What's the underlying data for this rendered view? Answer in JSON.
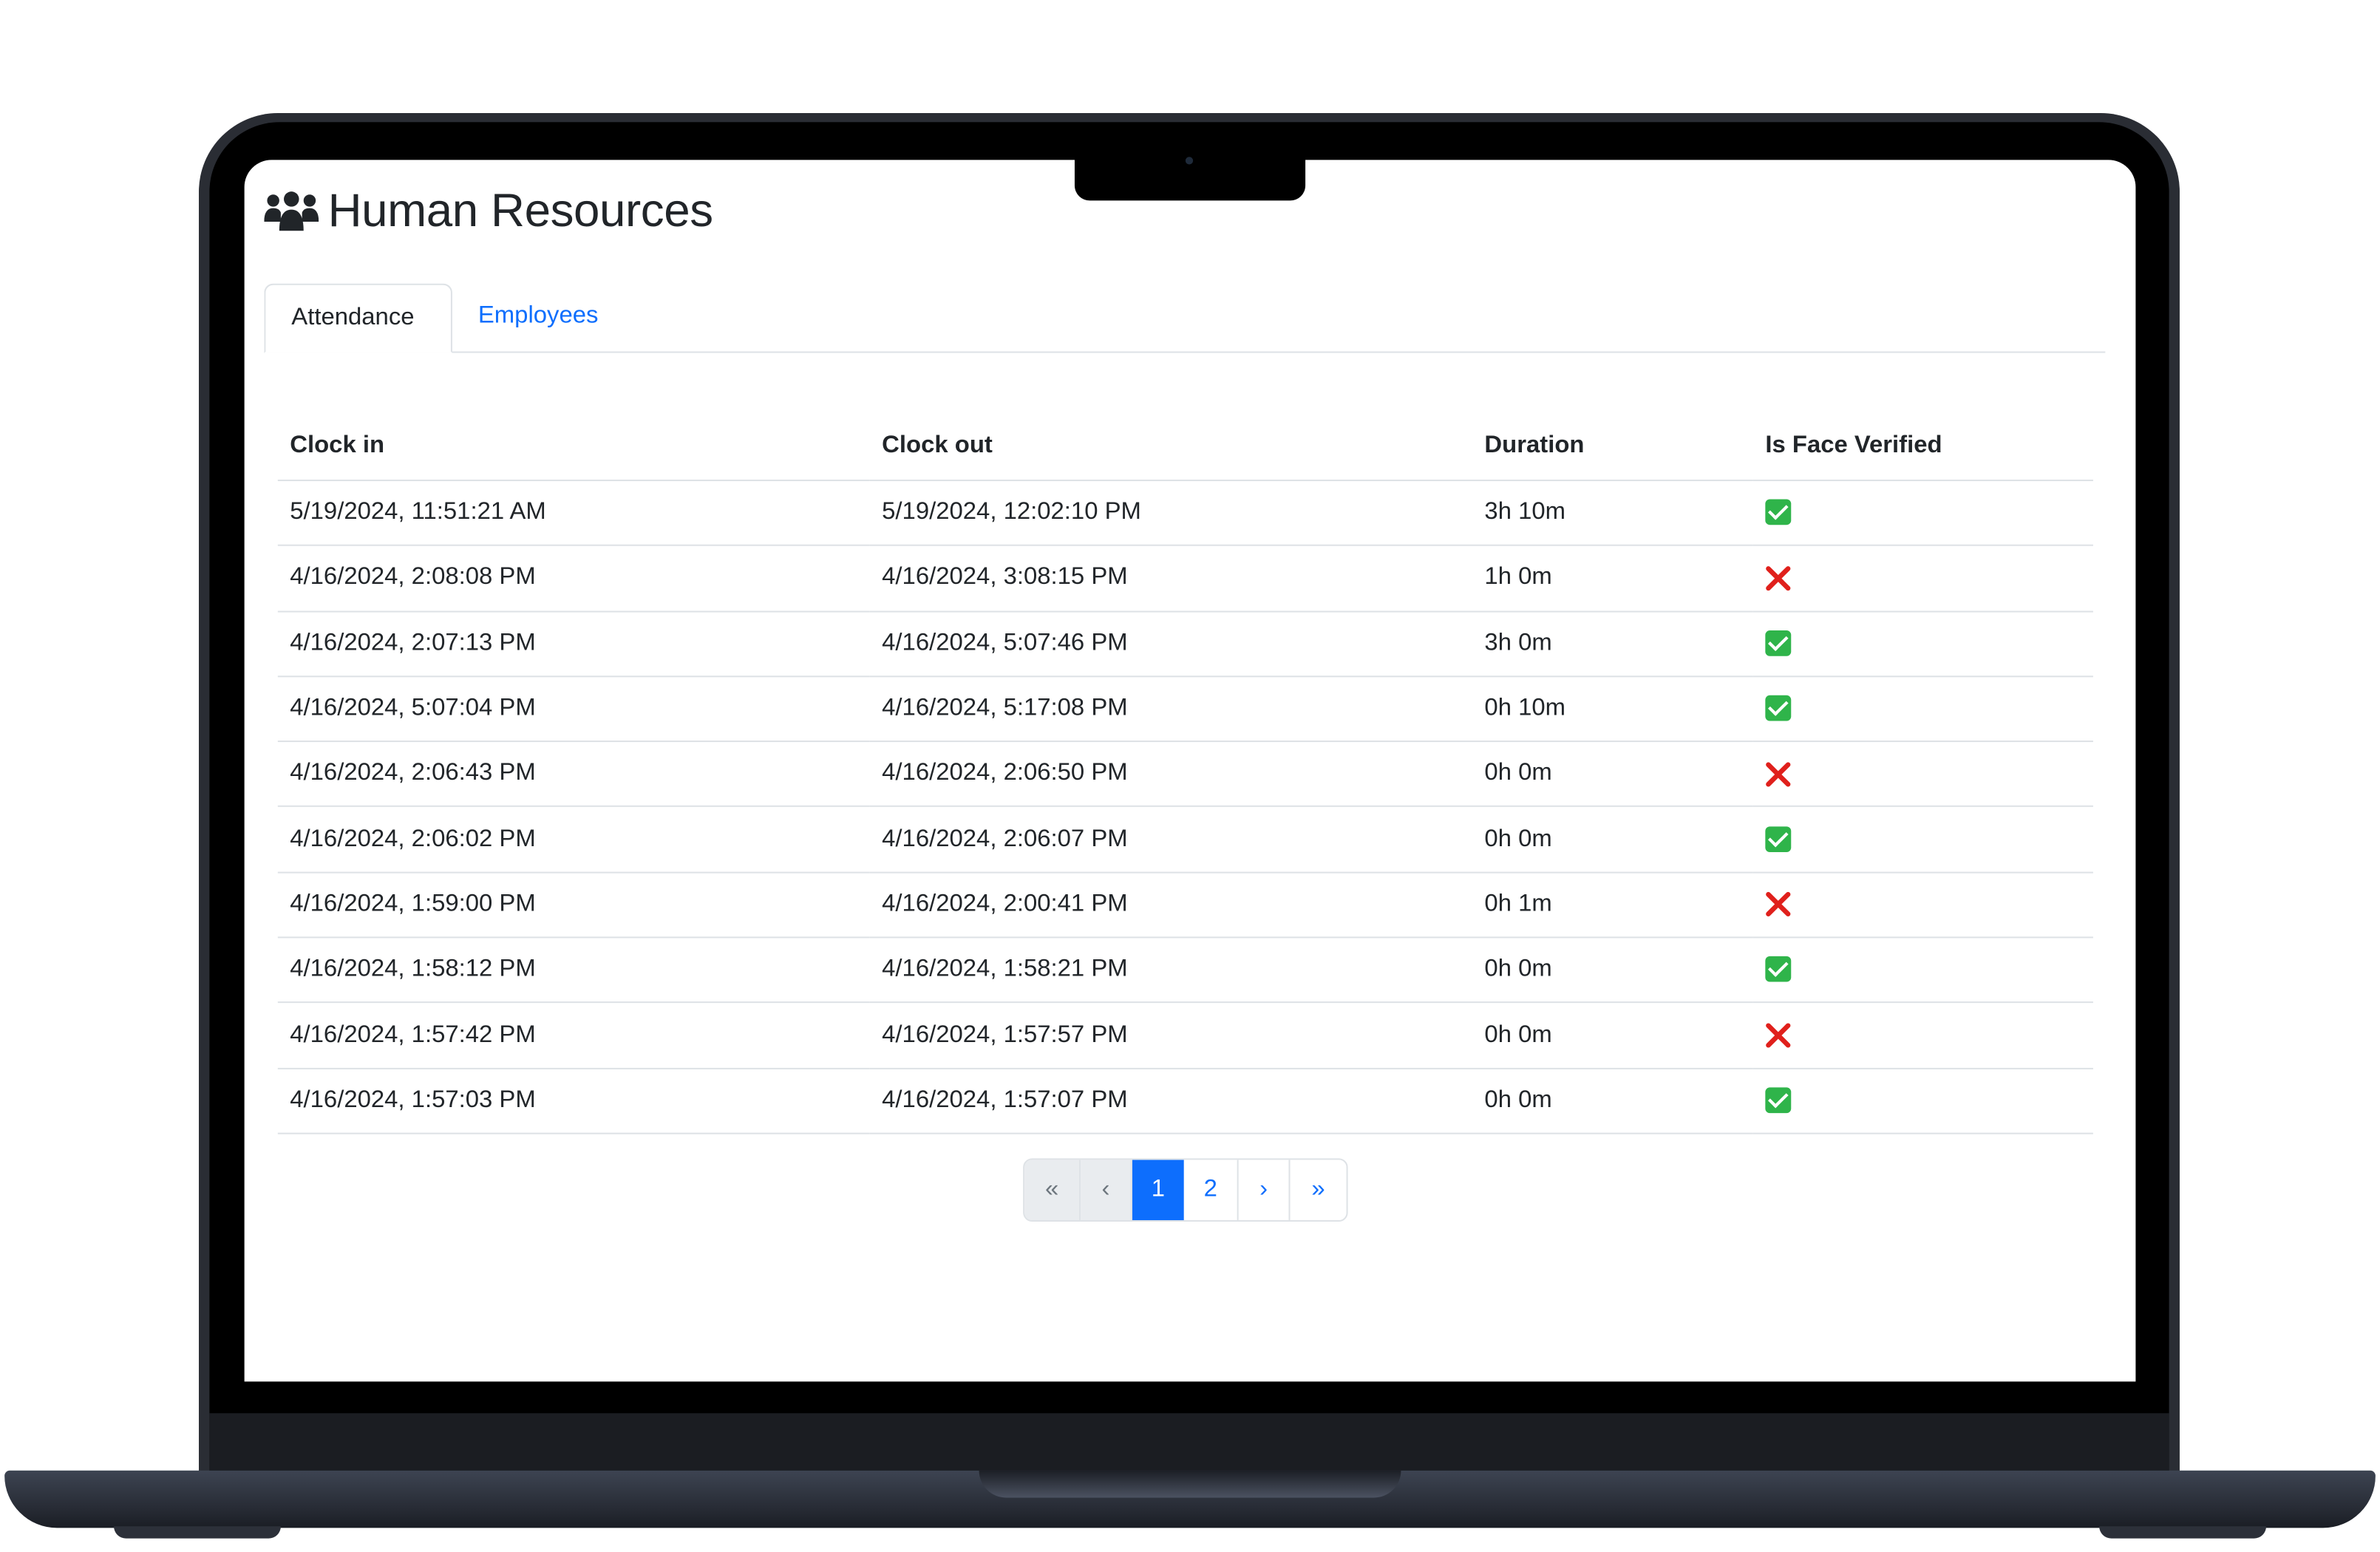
{
  "header": {
    "title": "Human Resources",
    "icon": "users-icon"
  },
  "tabs": [
    {
      "label": "Attendance",
      "active": true
    },
    {
      "label": "Employees",
      "active": false
    }
  ],
  "table": {
    "columns": [
      "Clock in",
      "Clock out",
      "Duration",
      "Is Face Verified"
    ],
    "rows": [
      {
        "clock_in": "5/19/2024, 11:51:21 AM",
        "clock_out": "5/19/2024, 12:02:10 PM",
        "duration": "3h 10m",
        "verified": true
      },
      {
        "clock_in": "4/16/2024, 2:08:08 PM",
        "clock_out": "4/16/2024, 3:08:15 PM",
        "duration": "1h 0m",
        "verified": false
      },
      {
        "clock_in": "4/16/2024, 2:07:13 PM",
        "clock_out": "4/16/2024, 5:07:46 PM",
        "duration": "3h 0m",
        "verified": true
      },
      {
        "clock_in": "4/16/2024, 5:07:04 PM",
        "clock_out": "4/16/2024, 5:17:08 PM",
        "duration": "0h 10m",
        "verified": true
      },
      {
        "clock_in": "4/16/2024, 2:06:43 PM",
        "clock_out": "4/16/2024, 2:06:50 PM",
        "duration": "0h 0m",
        "verified": false
      },
      {
        "clock_in": "4/16/2024, 2:06:02 PM",
        "clock_out": "4/16/2024, 2:06:07 PM",
        "duration": "0h 0m",
        "verified": true
      },
      {
        "clock_in": "4/16/2024, 1:59:00 PM",
        "clock_out": "4/16/2024, 2:00:41 PM",
        "duration": "0h 1m",
        "verified": false
      },
      {
        "clock_in": "4/16/2024, 1:58:12 PM",
        "clock_out": "4/16/2024, 1:58:21 PM",
        "duration": "0h 0m",
        "verified": true
      },
      {
        "clock_in": "4/16/2024, 1:57:42 PM",
        "clock_out": "4/16/2024, 1:57:57 PM",
        "duration": "0h 0m",
        "verified": false
      },
      {
        "clock_in": "4/16/2024, 1:57:03 PM",
        "clock_out": "4/16/2024, 1:57:07 PM",
        "duration": "0h 0m",
        "verified": true
      }
    ]
  },
  "pagination": {
    "first": "«",
    "prev": "‹",
    "pages": [
      "1",
      "2"
    ],
    "current": "1",
    "next": "›",
    "last": "»"
  },
  "colors": {
    "accent": "#0d6efd",
    "verified": "#2fb44a",
    "unverified": "#e0201c"
  }
}
